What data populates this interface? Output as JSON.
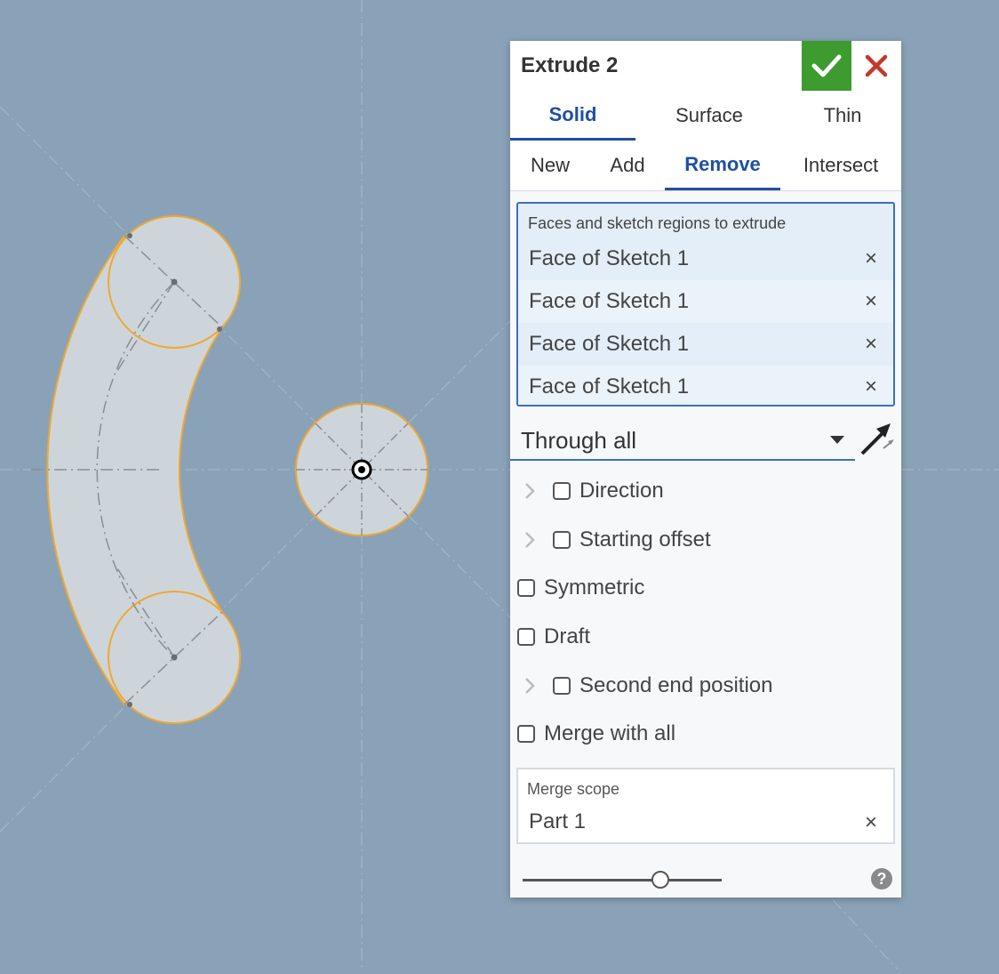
{
  "feature": {
    "title": "Extrude 2",
    "accept_icon": "checkmark-icon",
    "cancel_icon": "close-icon"
  },
  "type_tabs": [
    {
      "label": "Solid",
      "active": true
    },
    {
      "label": "Surface",
      "active": false
    },
    {
      "label": "Thin",
      "active": false
    }
  ],
  "operation_tabs": [
    {
      "label": "New",
      "active": false
    },
    {
      "label": "Add",
      "active": false
    },
    {
      "label": "Remove",
      "active": true
    },
    {
      "label": "Intersect",
      "active": false
    }
  ],
  "selection": {
    "label": "Faces and sketch regions to extrude",
    "items": [
      "Face of Sketch 1",
      "Face of Sketch 1",
      "Face of Sketch 1",
      "Face of Sketch 1"
    ],
    "remove_glyph": "×"
  },
  "end_type": {
    "value": "Through all",
    "flip_icon": "flip-direction-arrow-icon"
  },
  "options": {
    "direction": {
      "label": "Direction",
      "checked": false
    },
    "starting_offset": {
      "label": "Starting offset",
      "checked": false
    },
    "symmetric": {
      "label": "Symmetric",
      "checked": false
    },
    "draft": {
      "label": "Draft",
      "checked": false
    },
    "second_end": {
      "label": "Second end position",
      "checked": false
    },
    "merge_all": {
      "label": "Merge with all",
      "checked": false
    }
  },
  "merge_scope": {
    "label": "Merge scope",
    "value": "Part 1",
    "remove_glyph": "×"
  },
  "preview_slider": {
    "value": 0.69
  },
  "help": {
    "glyph": "?"
  },
  "colors": {
    "viewport_bg": "#8aa2b7",
    "accept_green": "#3d9b2f",
    "cancel_red": "#c0392b",
    "active_tab_blue": "#1f4fa3",
    "sketch_edge_orange": "#f0a830",
    "region_fill": "#cdd5db"
  }
}
